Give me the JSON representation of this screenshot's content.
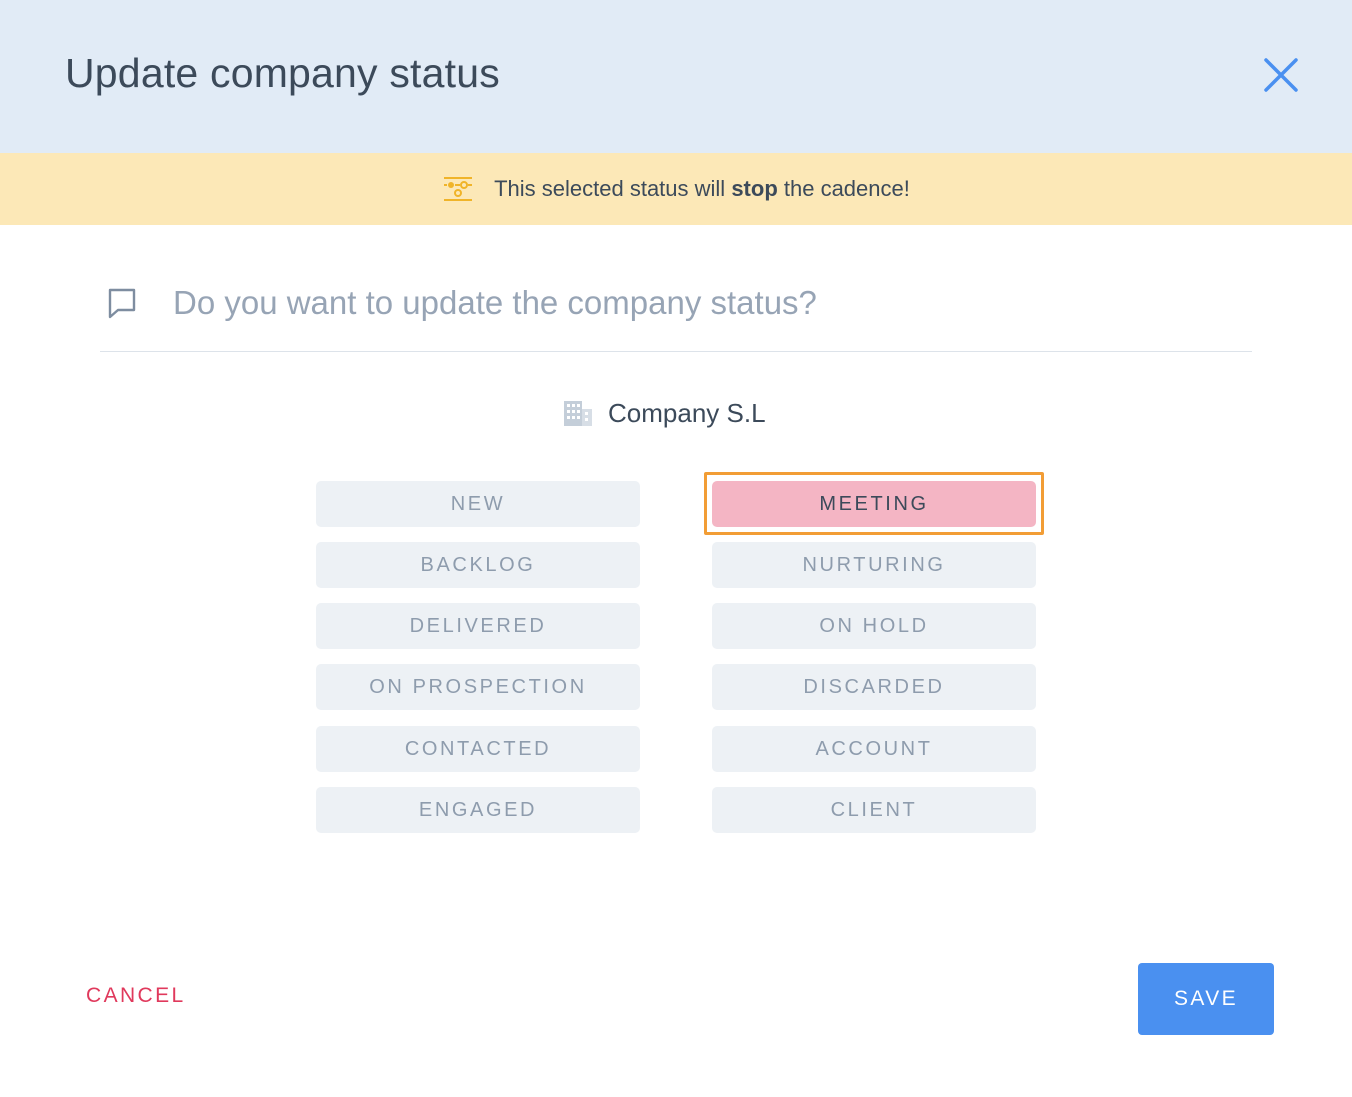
{
  "header": {
    "title": "Update company status",
    "close_icon": "close-icon"
  },
  "warning": {
    "icon": "sliders-icon",
    "text_before": "This selected status will ",
    "text_bold": "stop",
    "text_after": " the cadence!"
  },
  "question": {
    "icon": "comment-icon",
    "text": "Do you want to update the company status?"
  },
  "company": {
    "icon": "building-icon",
    "name": "Company S.L"
  },
  "statuses": {
    "left": [
      "NEW",
      "BACKLOG",
      "DELIVERED",
      "ON PROSPECTION",
      "CONTACTED",
      "ENGAGED"
    ],
    "right": [
      "MEETING",
      "NURTURING",
      "ON HOLD",
      "DISCARDED",
      "ACCOUNT",
      "CLIENT"
    ],
    "selected": "MEETING"
  },
  "footer": {
    "cancel_label": "CANCEL",
    "save_label": "SAVE"
  },
  "colors": {
    "header_bg": "#e1ebf6",
    "warning_bg": "#fce8b7",
    "selected_bg": "#f4b5c4",
    "highlight_border": "#f29d35",
    "cancel_text": "#e0395c",
    "save_bg": "#4a90f0",
    "close_icon": "#4a90f0"
  }
}
